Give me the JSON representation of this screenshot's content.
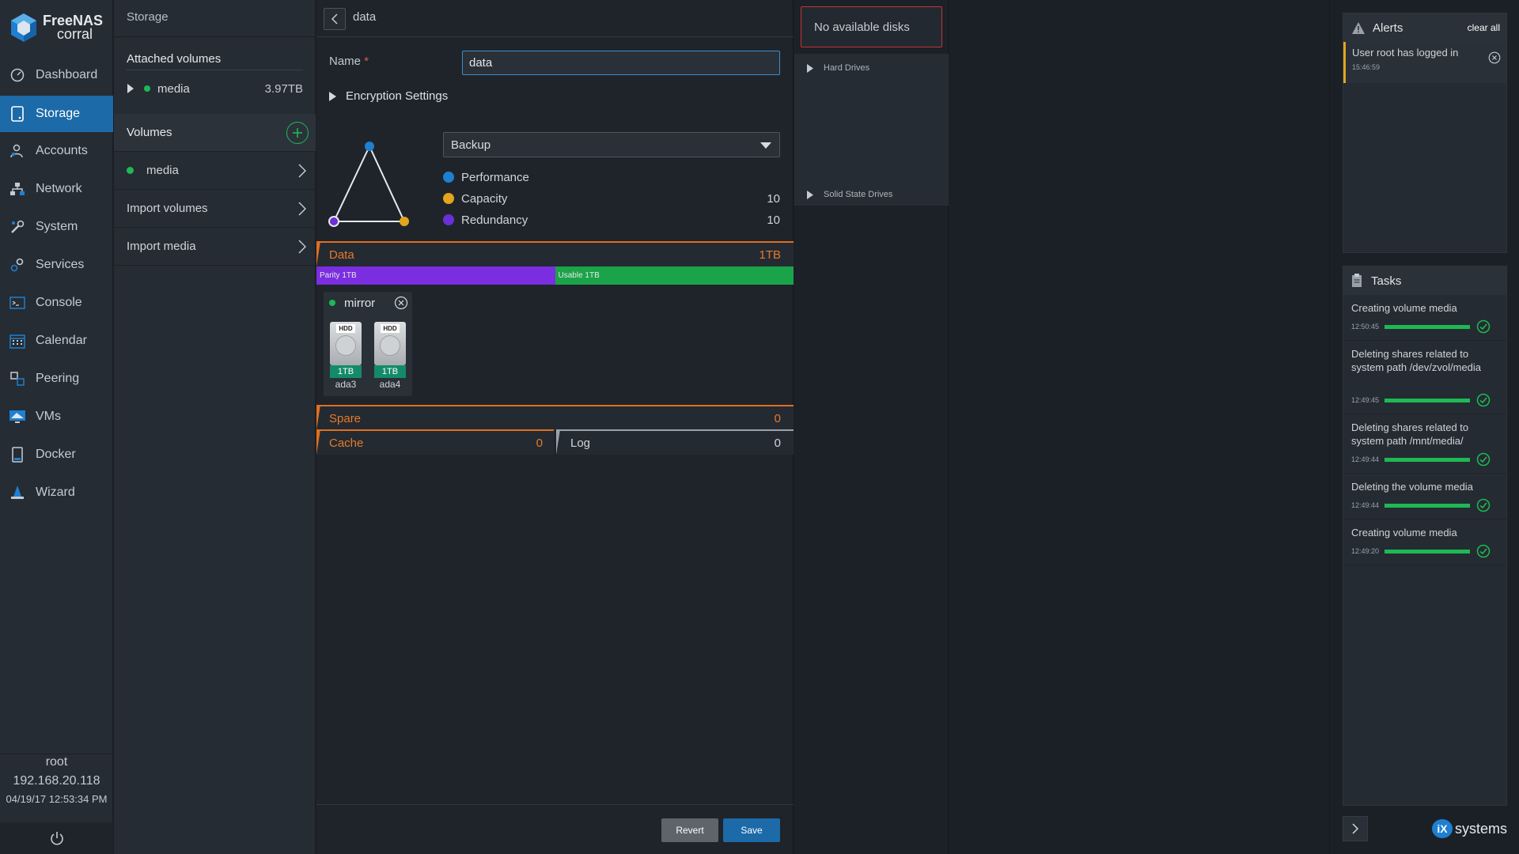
{
  "app": {
    "logo_line1": "FreeNAS",
    "logo_line2": "corral"
  },
  "nav": {
    "items": [
      {
        "label": "Dashboard",
        "icon": "dashboard-icon"
      },
      {
        "label": "Storage",
        "icon": "storage-icon",
        "active": true
      },
      {
        "label": "Accounts",
        "icon": "accounts-icon"
      },
      {
        "label": "Network",
        "icon": "network-icon"
      },
      {
        "label": "System",
        "icon": "system-icon"
      },
      {
        "label": "Services",
        "icon": "services-icon"
      },
      {
        "label": "Console",
        "icon": "console-icon"
      },
      {
        "label": "Calendar",
        "icon": "calendar-icon"
      },
      {
        "label": "Peering",
        "icon": "peering-icon"
      },
      {
        "label": "VMs",
        "icon": "vms-icon"
      },
      {
        "label": "Docker",
        "icon": "docker-icon"
      },
      {
        "label": "Wizard",
        "icon": "wizard-icon"
      }
    ],
    "user": "root",
    "ip": "192.168.20.118",
    "datetime": "04/19/17  12:53:34 PM"
  },
  "storage": {
    "title": "Storage",
    "attached_title": "Attached volumes",
    "attached": [
      {
        "name": "media",
        "size": "3.97TB"
      }
    ],
    "volumes_title": "Volumes",
    "volumes": [
      {
        "name": "media"
      }
    ],
    "import_volumes": "Import volumes",
    "import_media": "Import media"
  },
  "editor": {
    "title": "data",
    "name_label": "Name",
    "name_required": "*",
    "name_value": "data",
    "encryption_label": "Encryption Settings",
    "preset": "Backup",
    "legend": [
      {
        "label": "Performance",
        "value": "",
        "color": "#1f7fd0"
      },
      {
        "label": "Capacity",
        "value": "10",
        "color": "#e3a51e"
      },
      {
        "label": "Redundancy",
        "value": "10",
        "color": "#6a2fd6"
      }
    ],
    "data_label": "Data",
    "data_value": "1TB",
    "parity_label": "Parity 1TB",
    "usable_label": "Usable 1TB",
    "parity_fraction": 0.5,
    "vdev_type": "mirror",
    "disks": [
      {
        "badge": "HDD",
        "size": "1TB",
        "name": "ada3"
      },
      {
        "badge": "HDD",
        "size": "1TB",
        "name": "ada4"
      }
    ],
    "spare_label": "Spare",
    "spare_value": "0",
    "cache_label": "Cache",
    "cache_value": "0",
    "log_label": "Log",
    "log_value": "0",
    "revert_label": "Revert",
    "save_label": "Save"
  },
  "disks_panel": {
    "no_disks": "No available disks",
    "hard_drives": "Hard Drives",
    "ssd": "Solid State Drives"
  },
  "alerts": {
    "title": "Alerts",
    "clear_all": "clear all",
    "items": [
      {
        "text": "User root has logged in",
        "time": "15:46:59"
      }
    ]
  },
  "tasks": {
    "title": "Tasks",
    "items": [
      {
        "text": "Creating volume media",
        "time": "12:50:45",
        "progress": 1.0
      },
      {
        "text": "Deleting shares related to system path /dev/zvol/media",
        "time": "12:49:45",
        "progress": 1.0
      },
      {
        "text": "Deleting shares related to system path /mnt/media/",
        "time": "12:49:44",
        "progress": 1.0
      },
      {
        "text": "Deleting the volume media",
        "time": "12:49:44",
        "progress": 1.0
      },
      {
        "text": "Creating volume media",
        "time": "12:49:20",
        "progress": 1.0
      }
    ]
  },
  "brand": {
    "vendor": "systems",
    "vendor_prefix": "iX"
  },
  "colors": {
    "accent": "#1c6aa8",
    "orange": "#e06f1f",
    "green": "#1db954",
    "purple": "#7a2ee0"
  }
}
